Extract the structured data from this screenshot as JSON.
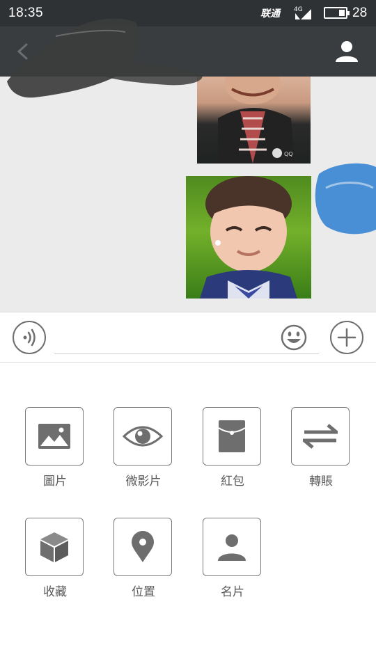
{
  "status_bar": {
    "time": "18:35",
    "carrier": "联通",
    "network": "4G",
    "battery_level": "28"
  },
  "header": {
    "back_icon": "back-arrow-icon",
    "profile_icon": "person-icon"
  },
  "chat": {
    "messages": [
      {
        "type": "image",
        "icon": "photo-boy-jacket"
      },
      {
        "type": "image",
        "icon": "photo-boy-smiling"
      }
    ]
  },
  "input": {
    "value": "",
    "placeholder": "",
    "voice_icon": "voice-icon",
    "emoji_icon": "emoji-icon",
    "plus_icon": "plus-icon"
  },
  "panel": {
    "items": [
      {
        "label": "圖片",
        "icon": "image-icon"
      },
      {
        "label": "微影片",
        "icon": "eye-icon"
      },
      {
        "label": "紅包",
        "icon": "red-envelope-icon"
      },
      {
        "label": "轉賬",
        "icon": "transfer-icon"
      },
      {
        "label": "收藏",
        "icon": "cube-icon"
      },
      {
        "label": "位置",
        "icon": "location-pin-icon"
      },
      {
        "label": "名片",
        "icon": "contact-card-icon"
      }
    ]
  },
  "colors": {
    "status_bar": "#2f3234",
    "header": "#3a3d3f",
    "chat_background": "#ebebeb",
    "icon_gray": "#6e6e6e"
  }
}
